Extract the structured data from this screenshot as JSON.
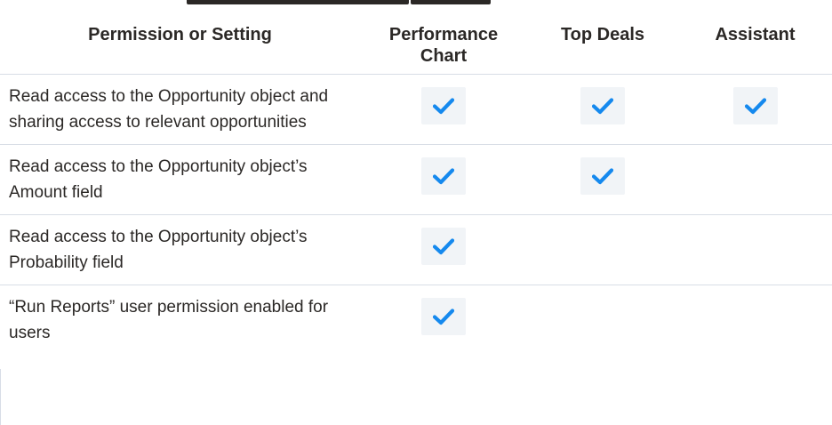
{
  "table": {
    "headers": [
      "Permission or Setting",
      "Performance Chart",
      "Top Deals",
      "Assistant"
    ],
    "rows": [
      {
        "setting": "Read access to the Opportunity object and sharing access to relevant opportunities",
        "checks": [
          true,
          true,
          true
        ]
      },
      {
        "setting": "Read access to the Opportunity object’s Amount field",
        "checks": [
          true,
          true,
          false
        ]
      },
      {
        "setting": "Read access to the Opportunity object’s Probability field",
        "checks": [
          true,
          false,
          false
        ]
      },
      {
        "setting": "“Run Reports” user permission enabled for users",
        "checks": [
          true,
          false,
          false
        ]
      }
    ]
  },
  "icons": {
    "check": "checkmark-icon"
  },
  "colors": {
    "check": "#1589ee",
    "check_bg": "#f1f4f7",
    "text": "#2b2826",
    "rule": "#d8dde6"
  }
}
